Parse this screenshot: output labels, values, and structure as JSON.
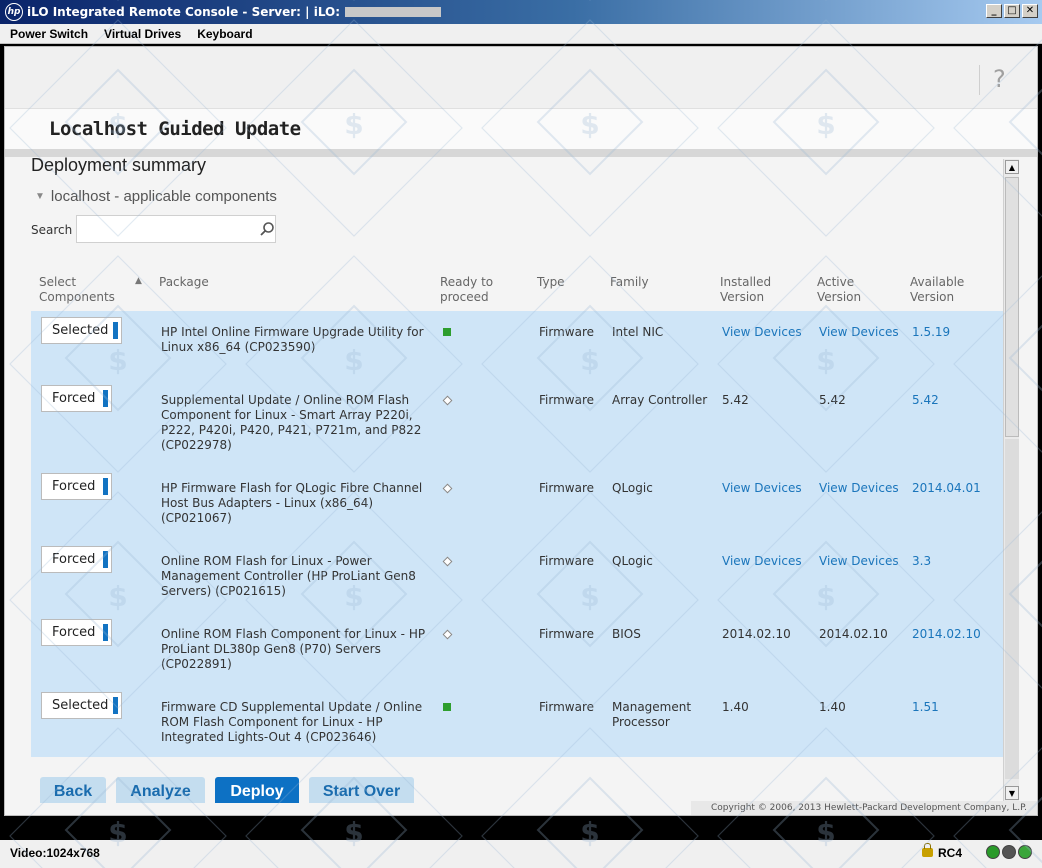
{
  "window": {
    "title": "iLO Integrated Remote Console - Server:  | iLO:",
    "hp_logo": "hp"
  },
  "menubar": {
    "items": [
      "Power Switch",
      "Virtual Drives",
      "Keyboard"
    ]
  },
  "app": {
    "title": "Localhost Guided Update",
    "help": "?"
  },
  "section": {
    "title": "Deployment summary",
    "subtitle": "localhost - applicable components",
    "search_label": "Search",
    "search_value": ""
  },
  "table": {
    "headers": {
      "select": "Select Components",
      "package": "Package",
      "ready": "Ready to proceed",
      "type": "Type",
      "family": "Family",
      "installed": "Installed Version",
      "active": "Active Version",
      "available": "Available Version"
    },
    "rows": [
      {
        "select": "Selected",
        "package": "HP Intel Online Firmware Upgrade Utility for Linux x86_64 (CP023590)",
        "ready": "green",
        "type": "Firmware",
        "family": "Intel NIC",
        "installed": "View Devices",
        "active": "View Devices",
        "available": "1.5.19"
      },
      {
        "select": "Forced",
        "package": "Supplemental Update / Online ROM Flash Component for Linux - Smart Array P220i, P222, P420i, P420, P421, P721m, and P822 (CP022978)",
        "ready": "diamond",
        "type": "Firmware",
        "family": "Array Controller",
        "installed": "5.42",
        "active": "5.42",
        "available": "5.42"
      },
      {
        "select": "Forced",
        "package": "HP Firmware Flash for QLogic Fibre Channel Host Bus Adapters - Linux (x86_64) (CP021067)",
        "ready": "diamond",
        "type": "Firmware",
        "family": "QLogic",
        "installed": "View Devices",
        "active": "View Devices",
        "available": "2014.04.01"
      },
      {
        "select": "Forced",
        "package": "Online ROM Flash for Linux - Power Management Controller (HP ProLiant Gen8 Servers) (CP021615)",
        "ready": "diamond",
        "type": "Firmware",
        "family": "QLogic",
        "installed": "View Devices",
        "active": "View Devices",
        "available": "3.3"
      },
      {
        "select": "Forced",
        "package": "Online ROM Flash Component for Linux - HP ProLiant DL380p Gen8 (P70) Servers (CP022891)",
        "ready": "diamond",
        "type": "Firmware",
        "family": "BIOS",
        "installed": "2014.02.10",
        "active": "2014.02.10",
        "available": "2014.02.10"
      },
      {
        "select": "Selected",
        "package": "Firmware CD Supplemental Update / Online ROM Flash Component for Linux - HP Integrated Lights-Out 4 (CP023646)",
        "ready": "green",
        "type": "Firmware",
        "family": "Management Processor",
        "installed": "1.40",
        "active": "1.40",
        "available": "1.51"
      }
    ]
  },
  "buttons": {
    "back": "Back",
    "analyze": "Analyze",
    "deploy": "Deploy",
    "start_over": "Start Over"
  },
  "copyright": "Copyright © 2006, 2013 Hewlett-Packard Development Company, L.P.",
  "status": {
    "video": "Video:1024x768",
    "encryption": "RC4"
  },
  "colors": {
    "accent": "#0d71c4",
    "row_bg": "#cfe5f7",
    "link": "#1a75bb",
    "ready_green": "#2e9e2e"
  }
}
